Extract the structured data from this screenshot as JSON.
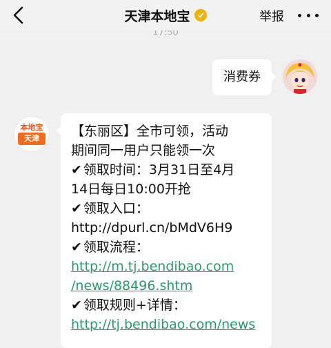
{
  "header": {
    "title": "天津本地宝",
    "report_label": "举报",
    "back_icon": "chevron-left-icon",
    "verified_icon": "verified-badge-icon",
    "more_icon": "more-dots-icon",
    "verified_color": "#f2b100"
  },
  "timestamp": "17:50",
  "outgoing": {
    "text": "消费券"
  },
  "brand_avatar": {
    "top_text": "本地宝",
    "bottom_text": "天津",
    "accent": "#f06a1f"
  },
  "incoming": {
    "lines": [
      {
        "text": "【东丽区】全市可领，活动",
        "link": false,
        "check": ""
      },
      {
        "text": "期间同一用户只能领一次",
        "link": false,
        "check": ""
      },
      {
        "text": "领取时间：3月31日至4月",
        "link": false,
        "check": "✔"
      },
      {
        "text": "14日每日10:00开抢",
        "link": false,
        "check": ""
      },
      {
        "text": "领取入口：",
        "link": false,
        "check": "✔"
      },
      {
        "text": "http://dpurl.cn/bMdV6H9",
        "link": false,
        "check": ""
      },
      {
        "text": "领取流程：",
        "link": false,
        "check": "✔"
      },
      {
        "text": "http://m.tj.bendibao.com",
        "link": true,
        "check": ""
      },
      {
        "text": "/news/88496.shtm",
        "link": true,
        "check": ""
      },
      {
        "text": "领取规则+详情：",
        "link": false,
        "check": "✔"
      },
      {
        "text": "http://tj.bendibao.com/news",
        "link": true,
        "check": ""
      }
    ],
    "link_color": "#2a9a6b"
  }
}
